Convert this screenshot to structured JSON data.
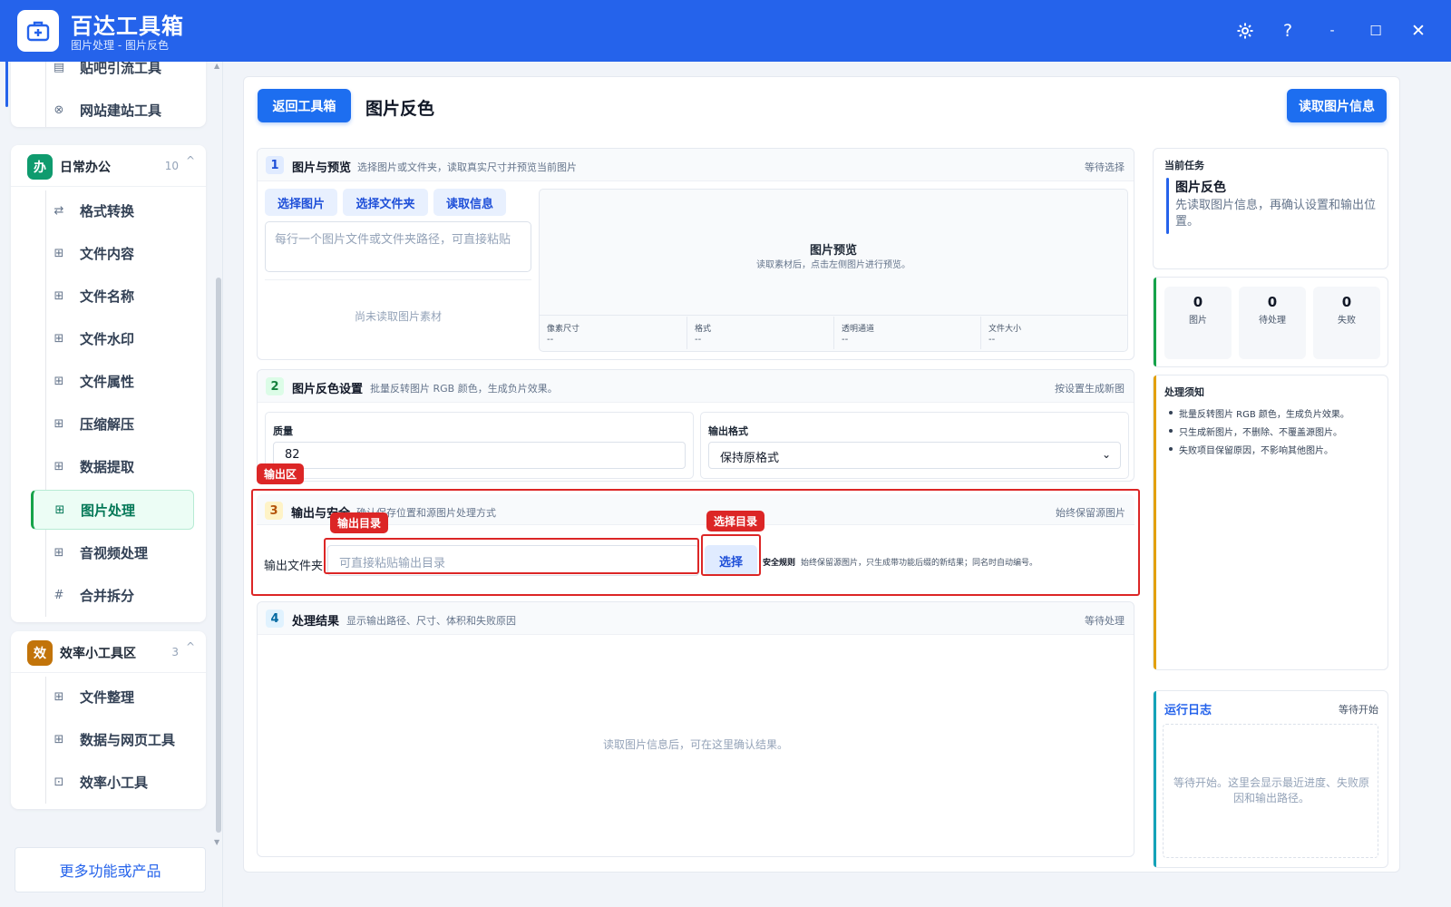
{
  "app": {
    "title": "百达工具箱",
    "subtitle": "图片处理 - 图片反色"
  },
  "window_controls": {
    "settings_icon": "gear-icon",
    "help": "?",
    "minimize": "-",
    "maximize": "☐",
    "close": "✕"
  },
  "sidebar": {
    "top_items": [
      {
        "label": "贴吧引流工具",
        "icon": "doc-icon"
      },
      {
        "label": "网站建站工具",
        "icon": "globe-icon"
      }
    ],
    "office_group": {
      "badge": "办",
      "badge_color": "#0f9b6e",
      "name": "日常办公",
      "count": "10",
      "caret": "^",
      "items": [
        {
          "label": "格式转换",
          "icon": "swap-icon"
        },
        {
          "label": "文件内容",
          "icon": "grid-icon"
        },
        {
          "label": "文件名称",
          "icon": "grid-icon"
        },
        {
          "label": "文件水印",
          "icon": "grid-icon"
        },
        {
          "label": "文件属性",
          "icon": "grid-icon"
        },
        {
          "label": "压缩解压",
          "icon": "grid-icon"
        },
        {
          "label": "数据提取",
          "icon": "grid-icon"
        },
        {
          "label": "图片处理",
          "icon": "grid-icon",
          "active": true
        },
        {
          "label": "音视频处理",
          "icon": "grid-icon"
        },
        {
          "label": "合并拆分",
          "icon": "hash-icon"
        }
      ]
    },
    "efficiency_group": {
      "badge": "效",
      "badge_color": "#c2740a",
      "name": "效率小工具区",
      "count": "3",
      "caret": "^",
      "items": [
        {
          "label": "文件整理",
          "icon": "grid-icon"
        },
        {
          "label": "数据与网页工具",
          "icon": "grid-icon"
        },
        {
          "label": "效率小工具",
          "icon": "toolbox-icon"
        }
      ]
    },
    "more_button": "更多功能或产品"
  },
  "main": {
    "back_button": "返回工具箱",
    "page_title": "图片反色",
    "read_info_button": "读取图片信息",
    "section1": {
      "num": "1",
      "title": "图片与预览",
      "desc": "选择图片或文件夹，读取真实尺寸并预览当前图片",
      "status": "等待选择",
      "btn_select_image": "选择图片",
      "btn_select_folder": "选择文件夹",
      "btn_read_info": "读取信息",
      "path_placeholder": "每行一个图片文件或文件夹路径，可直接粘贴",
      "empty_text": "尚未读取图片素材",
      "preview_title": "图片预览",
      "preview_desc": "读取素材后，点击左侧图片进行预览。",
      "meta": [
        {
          "label": "像素尺寸",
          "value": "--"
        },
        {
          "label": "格式",
          "value": "--"
        },
        {
          "label": "透明通道",
          "value": "--"
        },
        {
          "label": "文件大小",
          "value": "--"
        }
      ]
    },
    "section2": {
      "num": "2",
      "title": "图片反色设置",
      "desc": "批量反转图片 RGB 颜色，生成负片效果。",
      "status": "按设置生成新图",
      "quality_label": "质量",
      "quality_value": "82",
      "format_label": "输出格式",
      "format_value": "保持原格式"
    },
    "section3": {
      "num": "3",
      "title": "输出与安全",
      "desc": "确认保存位置和源图片处理方式",
      "status": "始终保留源图片",
      "output_label": "输出文件夹",
      "output_placeholder": "可直接粘贴输出目录",
      "choose_button": "选择",
      "safety_label": "安全规则",
      "safety_text": "始终保留源图片，只生成带功能后缀的新结果；同名时自动编号。"
    },
    "section4": {
      "num": "4",
      "title": "处理结果",
      "desc": "显示输出路径、尺寸、体积和失败原因",
      "status": "等待处理",
      "empty_text": "读取图片信息后，可在这里确认结果。"
    },
    "annotations": {
      "output_area": "输出区",
      "output_dir": "输出目录",
      "choose_dir": "选择目录"
    }
  },
  "right_panel": {
    "task": {
      "label": "当前任务",
      "title": "图片反色",
      "desc": "先读取图片信息，再确认设置和输出位置。"
    },
    "stats": [
      {
        "value": "0",
        "label": "图片"
      },
      {
        "value": "0",
        "label": "待处理"
      },
      {
        "value": "0",
        "label": "失败"
      }
    ],
    "notice": {
      "title": "处理须知",
      "items": [
        "批量反转图片 RGB 颜色，生成负片效果。",
        "只生成新图片，不删除、不覆盖源图片。",
        "失败项目保留原因，不影响其他图片。"
      ]
    },
    "log": {
      "title": "运行日志",
      "status": "等待开始",
      "empty": "等待开始。这里会显示最近进度、失败原因和输出路径。"
    }
  },
  "colors": {
    "titlebar": "#2563eb",
    "primary": "#1d6ef0",
    "annotation": "#dc2626",
    "accent_green": "#16a34a",
    "accent_orange": "#e3a008",
    "accent_blue": "#2563eb",
    "accent_teal": "#14a3b8"
  }
}
